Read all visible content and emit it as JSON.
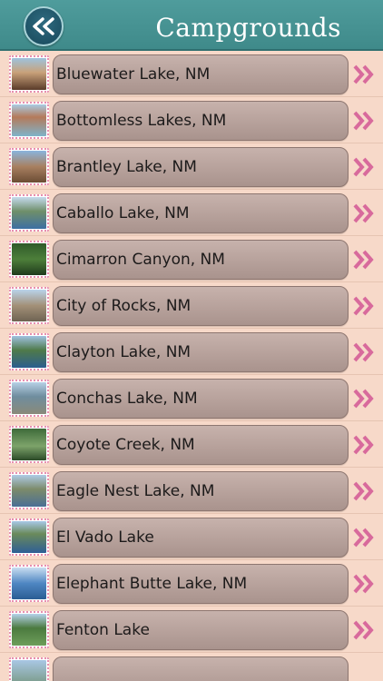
{
  "header": {
    "title": "Campgrounds",
    "back_icon": "double-chevron-left-icon"
  },
  "list": {
    "items": [
      {
        "label": "Bluewater Lake, NM"
      },
      {
        "label": "Bottomless Lakes, NM"
      },
      {
        "label": "Brantley Lake, NM"
      },
      {
        "label": "Caballo Lake, NM"
      },
      {
        "label": "Cimarron Canyon, NM"
      },
      {
        "label": "City of Rocks, NM"
      },
      {
        "label": "Clayton Lake, NM"
      },
      {
        "label": "Conchas Lake, NM"
      },
      {
        "label": "Coyote Creek, NM"
      },
      {
        "label": "Eagle Nest Lake, NM"
      },
      {
        "label": "El Vado Lake"
      },
      {
        "label": "Elephant Butte Lake, NM"
      },
      {
        "label": "Fenton Lake"
      }
    ]
  },
  "colors": {
    "header": "#4f9c9c",
    "background": "#f7d9c9",
    "pill": "#b9a39d",
    "arrow": "#d86a9c"
  }
}
